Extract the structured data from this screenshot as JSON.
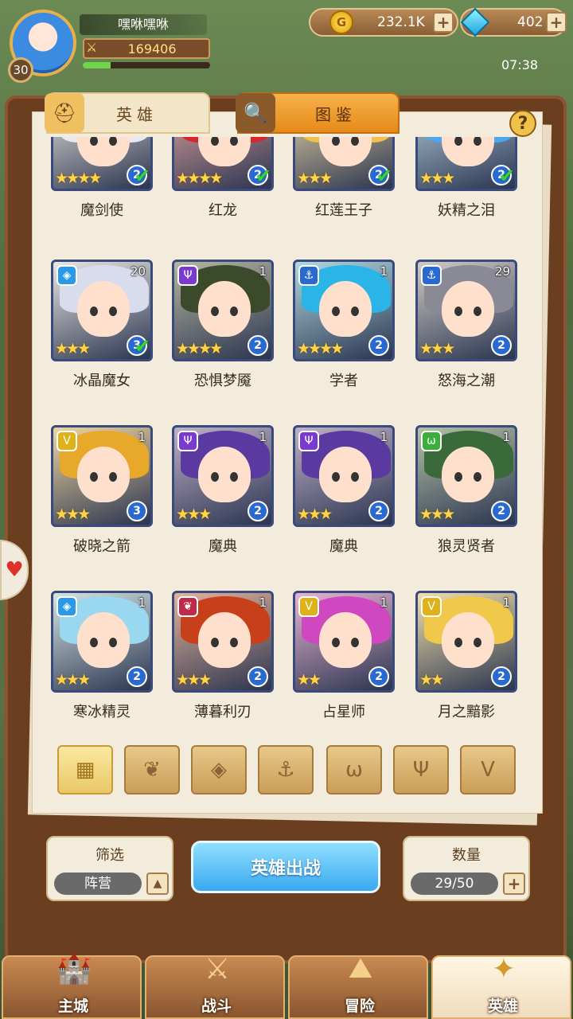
{
  "player": {
    "name": "嘿咻嘿咻",
    "level": "30",
    "power": "169406",
    "xp_fraction": 0.22
  },
  "resources": {
    "gold": "232.1K",
    "gems": "402"
  },
  "clock": "07:38",
  "tabs": {
    "heroes": "英雄",
    "codex": "图鉴"
  },
  "help": "?",
  "heroes": [
    {
      "name": "魔剑使",
      "stars": "★★★★",
      "rank": "2",
      "check": true,
      "hair": "#e8e8ee",
      "faction": "",
      "count": ""
    },
    {
      "name": "红龙",
      "stars": "★★★★",
      "rank": "2",
      "check": true,
      "hair": "#d8262e",
      "faction": "",
      "count": ""
    },
    {
      "name": "红莲王子",
      "stars": "★★★",
      "rank": "2",
      "check": true,
      "hair": "#f2c04a",
      "faction": "",
      "count": ""
    },
    {
      "name": "妖精之泪",
      "stars": "★★★",
      "rank": "2",
      "check": true,
      "hair": "#4aa8f0",
      "faction": "",
      "count": ""
    },
    {
      "name": "冰晶魔女",
      "stars": "★★★",
      "rank": "3",
      "check": true,
      "hair": "#d8dcec",
      "faction": "◈",
      "fcolor": "#2a9ae8",
      "count": "20"
    },
    {
      "name": "恐惧梦魇",
      "stars": "★★★★",
      "rank": "2",
      "check": false,
      "hair": "#3a4a2a",
      "faction": "Ψ",
      "fcolor": "#7a3ad0",
      "count": "1"
    },
    {
      "name": "学者",
      "stars": "★★★★",
      "rank": "2",
      "check": false,
      "hair": "#2ab4e8",
      "faction": "⚓",
      "fcolor": "#2a6ad0",
      "count": "1"
    },
    {
      "name": "怒海之潮",
      "stars": "★★★",
      "rank": "2",
      "check": false,
      "hair": "#8a8a96",
      "faction": "⚓",
      "fcolor": "#2a6ad0",
      "count": "29"
    },
    {
      "name": "破晓之箭",
      "stars": "★★★",
      "rank": "3",
      "check": false,
      "hair": "#e8a82a",
      "faction": "V",
      "fcolor": "#e0b21a",
      "count": "1"
    },
    {
      "name": "魔典",
      "stars": "★★★",
      "rank": "2",
      "check": false,
      "hair": "#5a3aa0",
      "faction": "Ψ",
      "fcolor": "#7a3ad0",
      "count": "1"
    },
    {
      "name": "魔典",
      "stars": "★★★",
      "rank": "2",
      "check": false,
      "hair": "#5a3aa0",
      "faction": "Ψ",
      "fcolor": "#7a3ad0",
      "count": "1"
    },
    {
      "name": "狼灵贤者",
      "stars": "★★★",
      "rank": "2",
      "check": false,
      "hair": "#3a6a3a",
      "faction": "ω",
      "fcolor": "#3ab03a",
      "count": "1"
    },
    {
      "name": "寒冰精灵",
      "stars": "★★★",
      "rank": "2",
      "check": false,
      "hair": "#9ad8f0",
      "faction": "◈",
      "fcolor": "#2a9ae8",
      "count": "1"
    },
    {
      "name": "薄暮利刃",
      "stars": "★★★",
      "rank": "2",
      "check": false,
      "hair": "#c8401a",
      "faction": "❦",
      "fcolor": "#c02a4a",
      "count": "1"
    },
    {
      "name": "占星师",
      "stars": "★★",
      "rank": "2",
      "check": false,
      "hair": "#d048c0",
      "faction": "V",
      "fcolor": "#e0b21a",
      "count": "1"
    },
    {
      "name": "月之黯影",
      "stars": "★★",
      "rank": "2",
      "check": false,
      "hair": "#f0c84a",
      "faction": "V",
      "fcolor": "#e0b21a",
      "count": "1"
    }
  ],
  "filters": [
    {
      "icon": "grid-icon",
      "glyph": "▦",
      "active": true
    },
    {
      "icon": "flame-icon",
      "glyph": "❦",
      "active": false
    },
    {
      "icon": "diamond-icon",
      "glyph": "◈",
      "active": false
    },
    {
      "icon": "anchor-icon",
      "glyph": "⚓",
      "active": false
    },
    {
      "icon": "beast-icon",
      "glyph": "ω",
      "active": false
    },
    {
      "icon": "wing-icon",
      "glyph": "Ψ",
      "active": false
    },
    {
      "icon": "chevron-icon",
      "glyph": "V",
      "active": false
    }
  ],
  "filter_panel": {
    "title": "筛选",
    "value": "阵营"
  },
  "deploy_label": "英雄出战",
  "count_panel": {
    "title": "数量",
    "value": "29/50"
  },
  "nav": [
    {
      "label": "主城",
      "icon": "castle-icon",
      "glyph": "🏰",
      "selected": false
    },
    {
      "label": "战斗",
      "icon": "swords-icon",
      "glyph": "⚔",
      "selected": false
    },
    {
      "label": "冒险",
      "icon": "map-icon",
      "glyph": "⛰",
      "selected": false
    },
    {
      "label": "英雄",
      "icon": "hero-crest-icon",
      "glyph": "✦",
      "selected": true
    }
  ]
}
